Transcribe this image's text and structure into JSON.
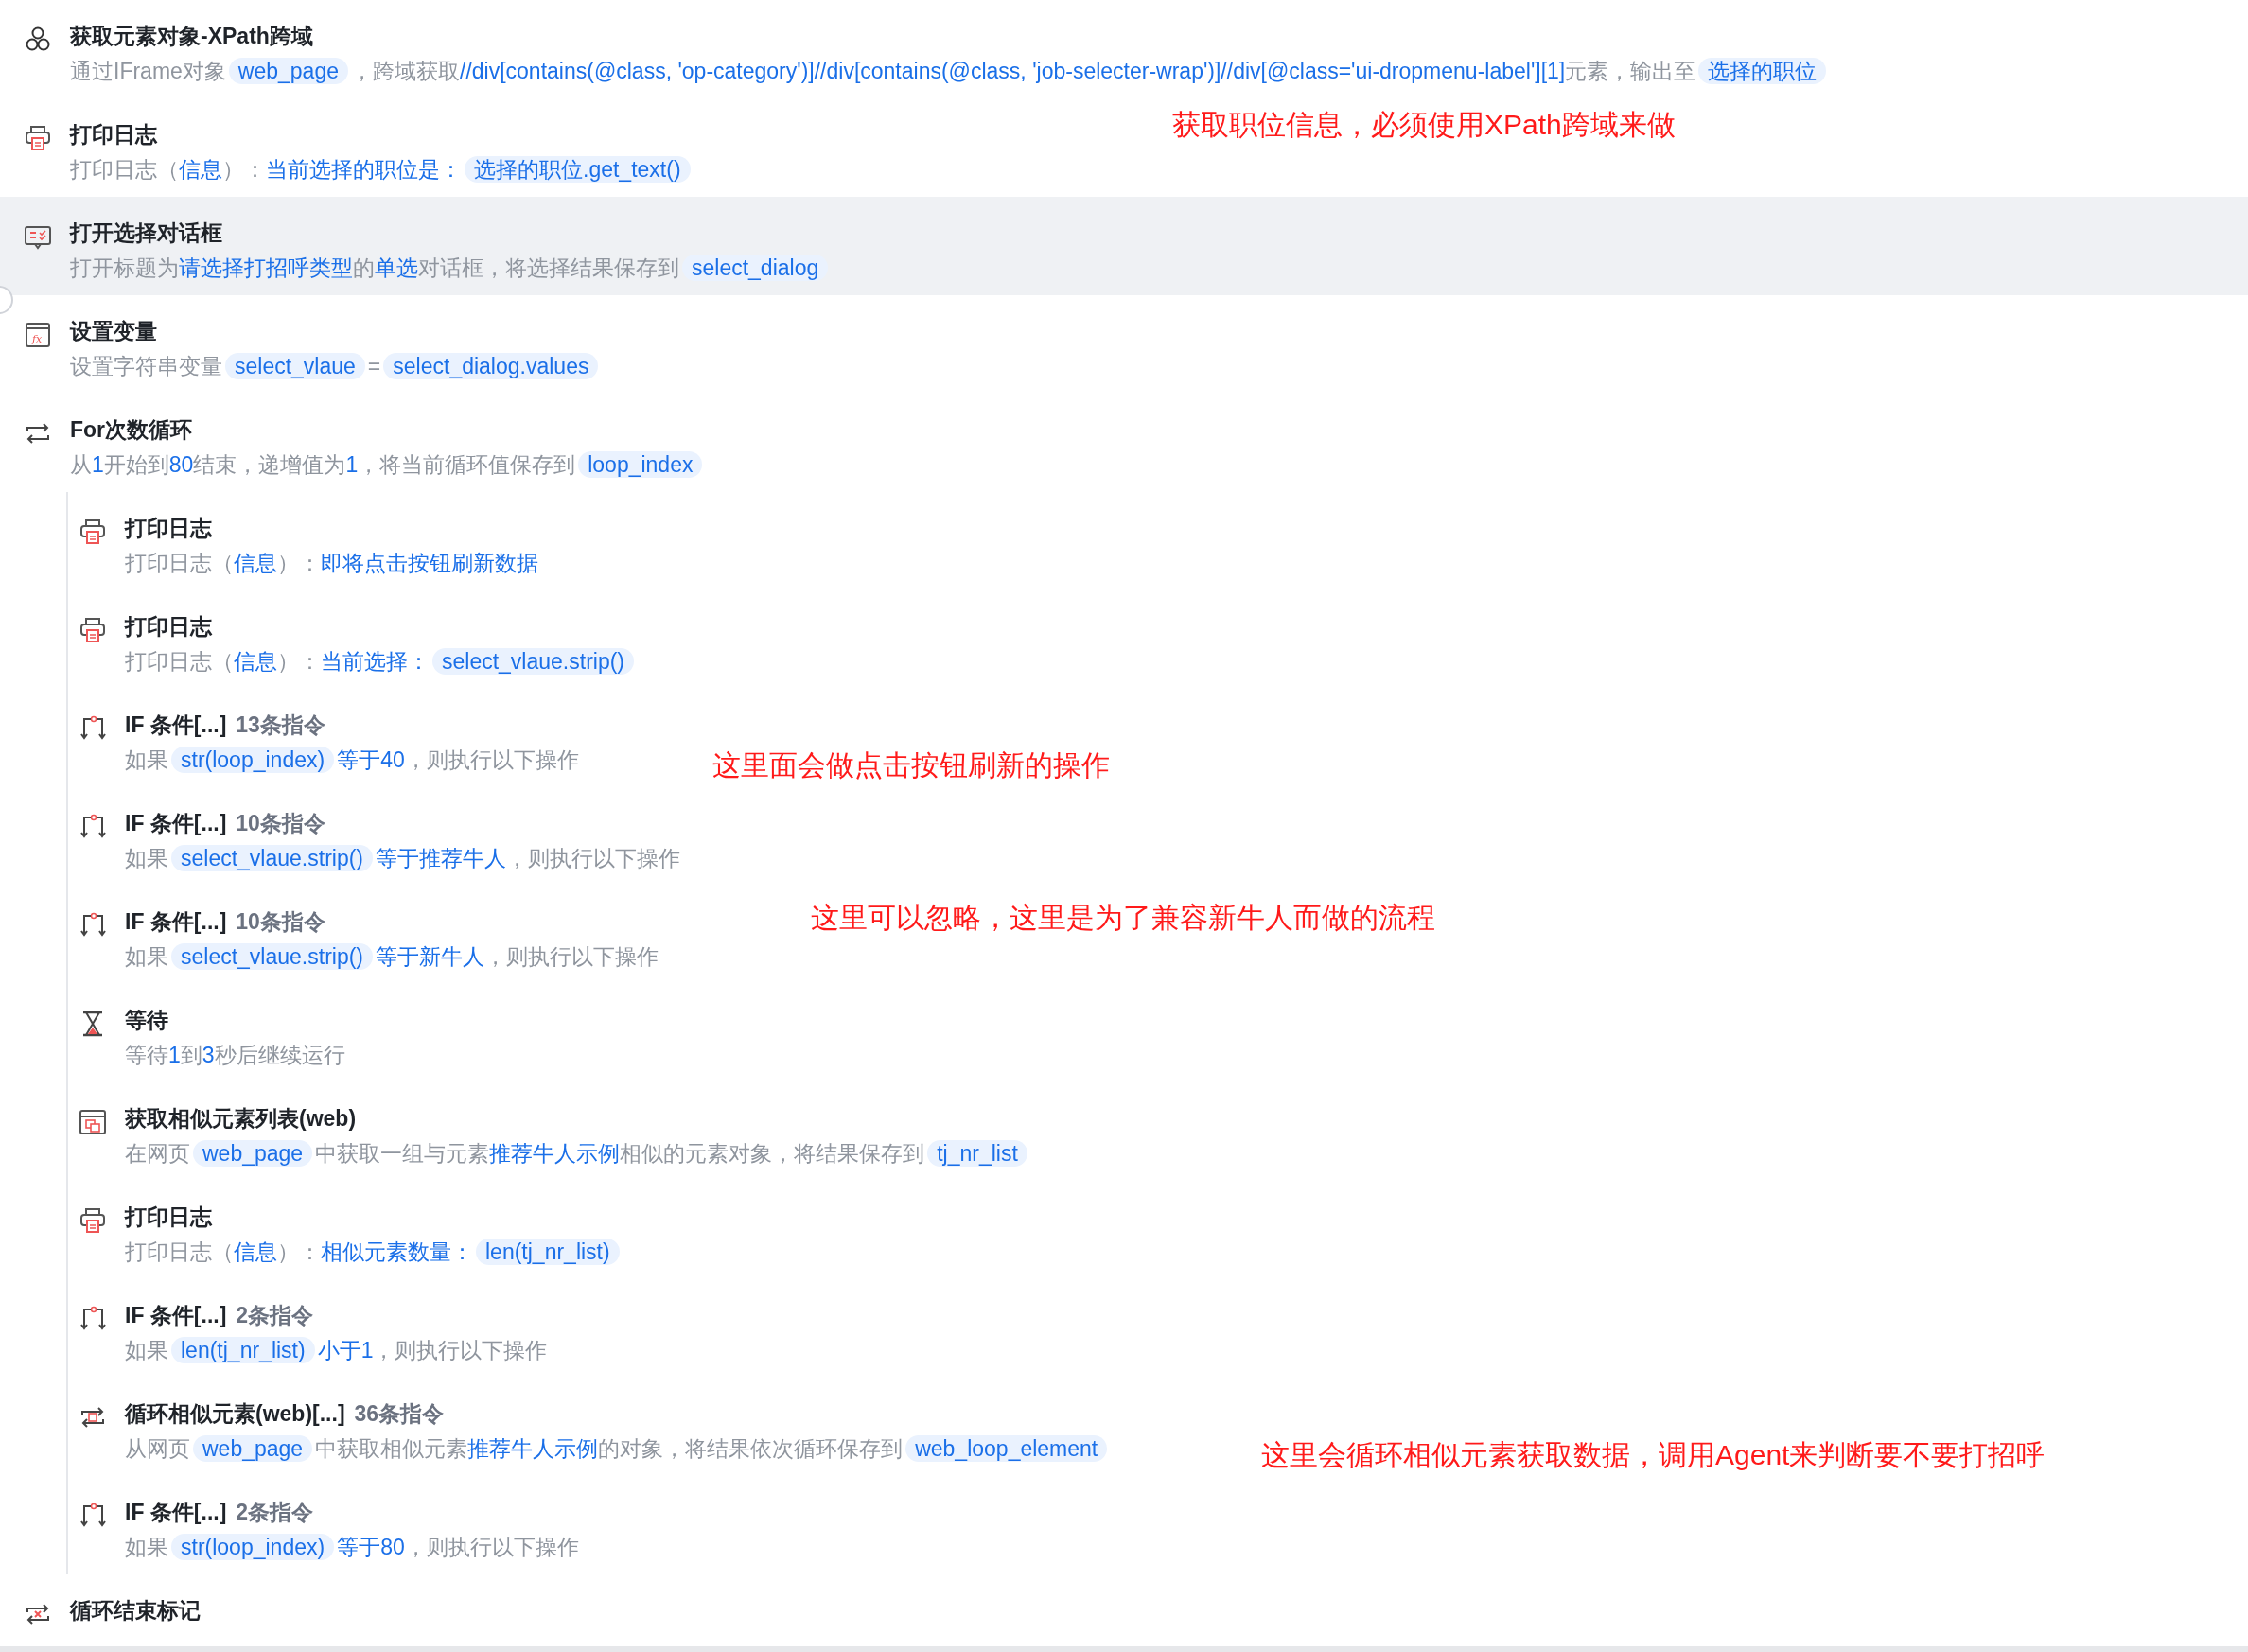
{
  "steps": [
    {
      "kind": "elements",
      "title": "获取元素对象-XPath跨域",
      "selected": false,
      "desc": [
        {
          "kind": "text",
          "text": "通过IFrame对象"
        },
        {
          "kind": "var",
          "text": "web_page"
        },
        {
          "kind": "text",
          "text": "，跨域获取"
        },
        {
          "kind": "link",
          "text": "//div[contains(@class, 'op-category')]//div[contains(@class, 'job-selecter-wrap')]//div[@class='ui-dropmenu-label'][1]"
        },
        {
          "kind": "text",
          "text": "元素，输出至"
        },
        {
          "kind": "var",
          "text": "选择的职位"
        }
      ]
    },
    {
      "kind": "printer",
      "title": "打印日志",
      "selected": false,
      "desc": [
        {
          "kind": "text",
          "text": "打印日志（"
        },
        {
          "kind": "link",
          "text": "信息"
        },
        {
          "kind": "text",
          "text": "）："
        },
        {
          "kind": "link",
          "text": "当前选择的职位是："
        },
        {
          "kind": "var",
          "text": "选择的职位.get_text()"
        }
      ]
    },
    {
      "kind": "dialog",
      "title": "打开选择对话框",
      "selected": true,
      "desc": [
        {
          "kind": "text",
          "text": "打开标题为"
        },
        {
          "kind": "link",
          "text": "请选择打招呼类型"
        },
        {
          "kind": "text",
          "text": "的"
        },
        {
          "kind": "link",
          "text": "单选"
        },
        {
          "kind": "text",
          "text": "对话框，将选择结果保存到"
        },
        {
          "kind": "var",
          "text": "select_dialog"
        }
      ]
    },
    {
      "kind": "fx",
      "title": "设置变量",
      "selected": false,
      "desc": [
        {
          "kind": "text",
          "text": "设置字符串变量"
        },
        {
          "kind": "var",
          "text": "select_vlaue"
        },
        {
          "kind": "text",
          "text": "="
        },
        {
          "kind": "var",
          "text": "select_dialog.values"
        }
      ]
    },
    {
      "kind": "loop",
      "title": "For次数循环",
      "selected": false,
      "desc": [
        {
          "kind": "text",
          "text": "从"
        },
        {
          "kind": "link",
          "text": "1"
        },
        {
          "kind": "text",
          "text": "开始到"
        },
        {
          "kind": "link",
          "text": "80"
        },
        {
          "kind": "text",
          "text": "结束，递增值为"
        },
        {
          "kind": "link",
          "text": "1"
        },
        {
          "kind": "text",
          "text": "，将当前循环值保存到"
        },
        {
          "kind": "var",
          "text": "loop_index"
        }
      ],
      "children": [
        {
          "kind": "printer",
          "title": "打印日志",
          "selected": false,
          "desc": [
            {
              "kind": "text",
              "text": "打印日志（"
            },
            {
              "kind": "link",
              "text": "信息"
            },
            {
              "kind": "text",
              "text": "）："
            },
            {
              "kind": "link",
              "text": "即将点击按钮刷新数据"
            }
          ]
        },
        {
          "kind": "printer",
          "title": "打印日志",
          "selected": false,
          "desc": [
            {
              "kind": "text",
              "text": "打印日志（"
            },
            {
              "kind": "link",
              "text": "信息"
            },
            {
              "kind": "text",
              "text": "）："
            },
            {
              "kind": "link",
              "text": "当前选择："
            },
            {
              "kind": "var",
              "text": "select_vlaue.strip()"
            }
          ]
        },
        {
          "kind": "branch",
          "title": "IF 条件[...]",
          "count": "13条指令",
          "selected": false,
          "desc": [
            {
              "kind": "text",
              "text": "如果"
            },
            {
              "kind": "var",
              "text": "str(loop_index)"
            },
            {
              "kind": "link",
              "text": "等于40"
            },
            {
              "kind": "text",
              "text": "，则执行以下操作"
            }
          ]
        },
        {
          "kind": "branch",
          "title": "IF 条件[...]",
          "count": "10条指令",
          "selected": false,
          "desc": [
            {
              "kind": "text",
              "text": "如果"
            },
            {
              "kind": "var",
              "text": "select_vlaue.strip()"
            },
            {
              "kind": "link",
              "text": "等于推荐牛人"
            },
            {
              "kind": "text",
              "text": "，则执行以下操作"
            }
          ]
        },
        {
          "kind": "branch",
          "title": "IF 条件[...]",
          "count": "10条指令",
          "selected": false,
          "desc": [
            {
              "kind": "text",
              "text": "如果"
            },
            {
              "kind": "var",
              "text": "select_vlaue.strip()"
            },
            {
              "kind": "link",
              "text": "等于新牛人"
            },
            {
              "kind": "text",
              "text": "，则执行以下操作"
            }
          ]
        },
        {
          "kind": "hourglass",
          "title": "等待",
          "selected": false,
          "desc": [
            {
              "kind": "text",
              "text": "等待"
            },
            {
              "kind": "link",
              "text": "1"
            },
            {
              "kind": "text",
              "text": "到"
            },
            {
              "kind": "link",
              "text": "3"
            },
            {
              "kind": "text",
              "text": "秒后继续运行"
            }
          ]
        },
        {
          "kind": "weblist",
          "title": "获取相似元素列表(web)",
          "selected": false,
          "desc": [
            {
              "kind": "text",
              "text": "在网页"
            },
            {
              "kind": "var",
              "text": "web_page"
            },
            {
              "kind": "text",
              "text": "中获取一组与元素"
            },
            {
              "kind": "link",
              "text": "推荐牛人示例"
            },
            {
              "kind": "text",
              "text": "相似的元素对象，将结果保存到"
            },
            {
              "kind": "var",
              "text": "tj_nr_list"
            }
          ]
        },
        {
          "kind": "printer",
          "title": "打印日志",
          "selected": false,
          "desc": [
            {
              "kind": "text",
              "text": "打印日志（"
            },
            {
              "kind": "link",
              "text": "信息"
            },
            {
              "kind": "text",
              "text": "）："
            },
            {
              "kind": "link",
              "text": "相似元素数量："
            },
            {
              "kind": "var",
              "text": "len(tj_nr_list)"
            }
          ]
        },
        {
          "kind": "branch",
          "title": "IF 条件[...]",
          "count": "2条指令",
          "selected": false,
          "desc": [
            {
              "kind": "text",
              "text": "如果"
            },
            {
              "kind": "var",
              "text": "len(tj_nr_list)"
            },
            {
              "kind": "link",
              "text": "小于1"
            },
            {
              "kind": "text",
              "text": "，则执行以下操作"
            }
          ]
        },
        {
          "kind": "webloop",
          "title": "循环相似元素(web)[...]",
          "count": "36条指令",
          "selected": false,
          "desc": [
            {
              "kind": "text",
              "text": "从网页"
            },
            {
              "kind": "var",
              "text": "web_page"
            },
            {
              "kind": "text",
              "text": "中获取相似元素"
            },
            {
              "kind": "link",
              "text": "推荐牛人示例"
            },
            {
              "kind": "text",
              "text": "的对象，将结果依次循环保存到"
            },
            {
              "kind": "var",
              "text": "web_loop_element"
            }
          ]
        },
        {
          "kind": "branch",
          "title": "IF 条件[...]",
          "count": "2条指令",
          "selected": false,
          "desc": [
            {
              "kind": "text",
              "text": "如果"
            },
            {
              "kind": "var",
              "text": "str(loop_index)"
            },
            {
              "kind": "link",
              "text": "等于80"
            },
            {
              "kind": "text",
              "text": "，则执行以下操作"
            }
          ]
        }
      ]
    },
    {
      "kind": "loopend",
      "title": "循环结束标记",
      "selected": false
    }
  ],
  "notes": [
    {
      "text": "获取职位信息，必须使用XPath跨域来做"
    },
    {
      "text": "这里面会做点击按钮刷新的操作"
    },
    {
      "text": "这里可以忽略，这里是为了兼容新牛人而做的流程"
    },
    {
      "text": "这里会循环相似元素获取数据，调用Agent来判断要不要打招呼"
    }
  ]
}
